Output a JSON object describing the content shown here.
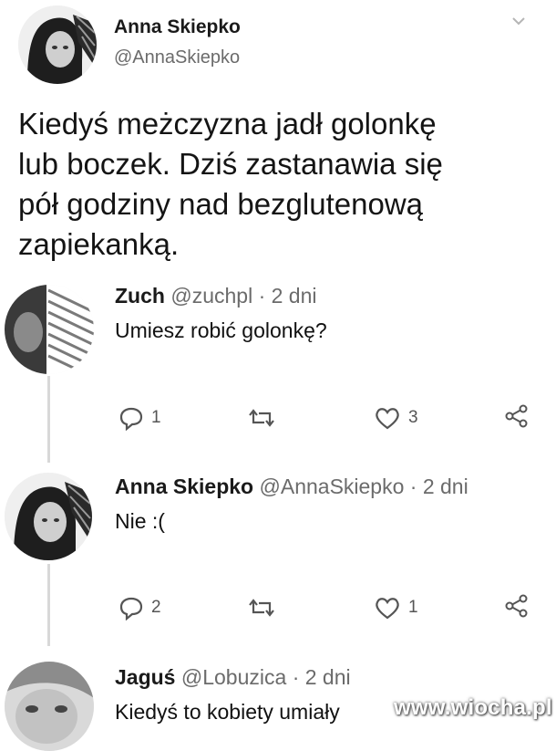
{
  "main_tweet": {
    "author_name": "Anna Skiepko",
    "author_handle": "@AnnaSkiepko",
    "text_lines": [
      "Kiedyś meżczyzna jadł golonkę",
      "lub boczek. Dziś zastanawia się",
      "pół godziny nad bezglutenową",
      "zapiekanką."
    ],
    "menu_icon": "chevron-down-icon"
  },
  "replies": [
    {
      "author_name": "Zuch",
      "author_handle": "@zuchpl",
      "time": "· 2 dni",
      "text": "Umiesz robić golonkę?",
      "reply_count": "1",
      "retweet_count": "",
      "like_count": "3"
    },
    {
      "author_name": "Anna Skiepko",
      "author_handle": "@AnnaSkiepko",
      "time": "· 2 dni",
      "text": "Nie :(",
      "reply_count": "2",
      "retweet_count": "",
      "like_count": "1"
    },
    {
      "author_name": "Jaguś",
      "author_handle": "@Lobuzica",
      "time": "· 2 dni",
      "text": "Kiedyś to kobiety umiały"
    }
  ],
  "watermark": "www.wiocha.pl",
  "colors": {
    "text": "#111111",
    "secondary": "#6b6b6b",
    "icon": "#555555",
    "thread_line": "#d8d8d8"
  },
  "icons": [
    "reply-icon",
    "retweet-icon",
    "like-icon",
    "share-icon",
    "chevron-down-icon"
  ]
}
